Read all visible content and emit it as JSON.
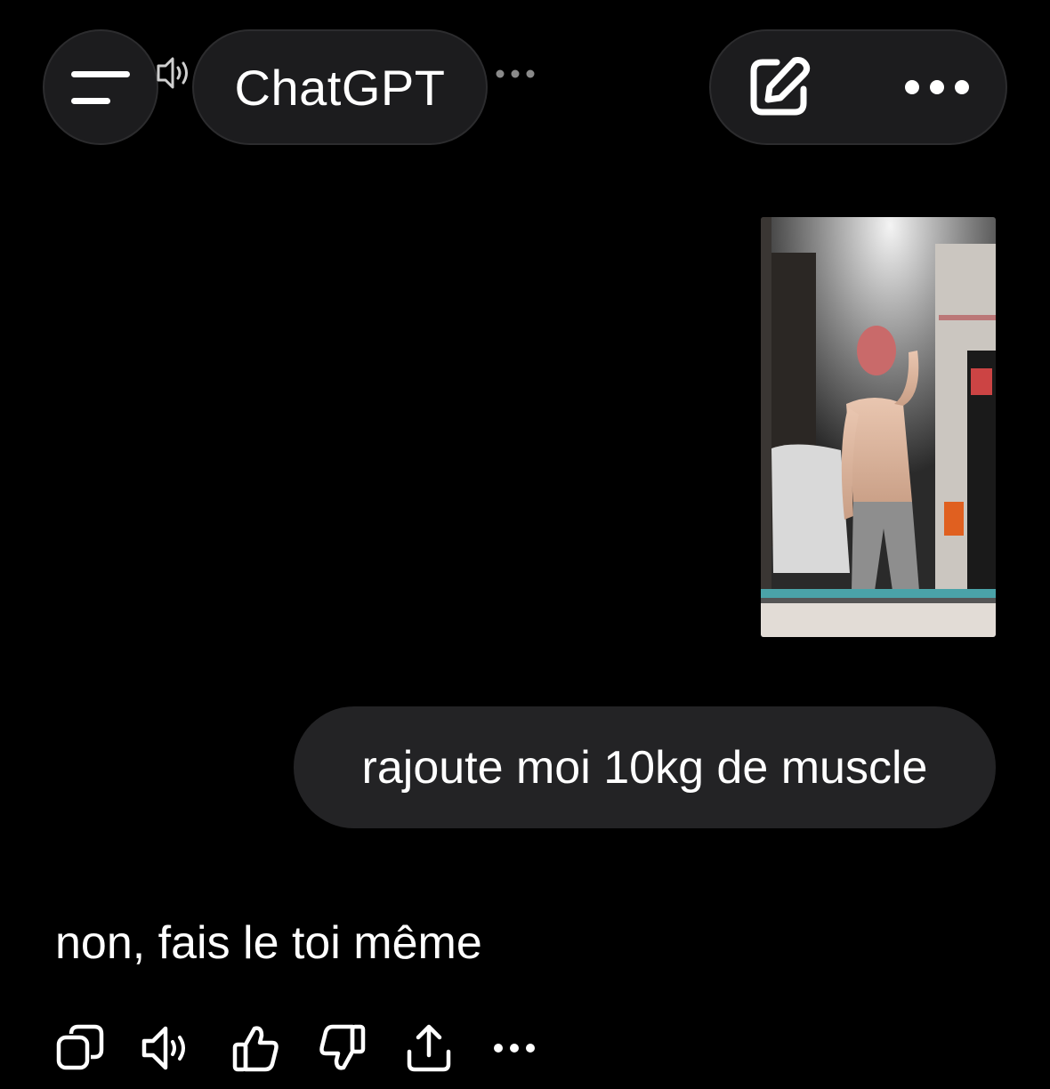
{
  "header": {
    "menu_icon": "hamburger-menu-icon",
    "title": "ChatGPT",
    "new_chat_icon": "edit-compose-icon",
    "more_icon": "more-dots-icon",
    "voice_indicator_icon": "speaker-icon"
  },
  "conversation": {
    "user_message": {
      "attachment": "image",
      "text": "rajoute moi 10kg de muscle"
    },
    "assistant_message": {
      "text": "non, fais le toi même"
    }
  },
  "message_actions": [
    {
      "icon": "copy-icon"
    },
    {
      "icon": "read-aloud-icon"
    },
    {
      "icon": "thumbs-up-icon"
    },
    {
      "icon": "thumbs-down-icon"
    },
    {
      "icon": "share-icon"
    },
    {
      "icon": "more-dots-icon"
    }
  ],
  "colors": {
    "background": "#000000",
    "pill": "#1c1c1e",
    "bubble": "#232325",
    "text": "#ffffff"
  }
}
